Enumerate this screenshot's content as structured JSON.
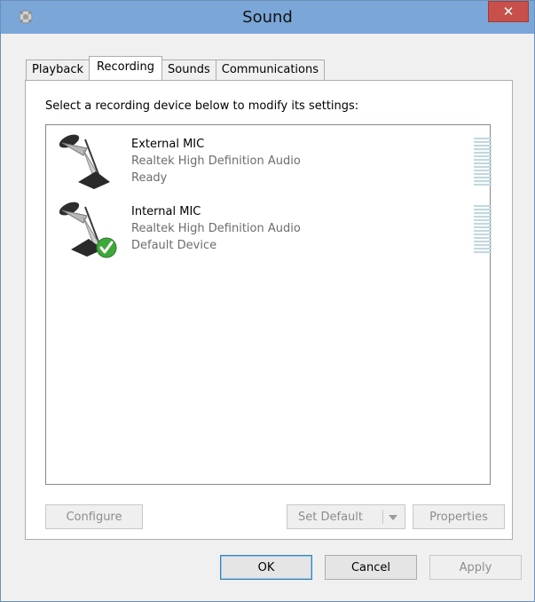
{
  "window": {
    "title": "Sound",
    "icon": "speaker-icon",
    "close_glyph": "✕"
  },
  "tabs": [
    {
      "label": "Playback",
      "active": false
    },
    {
      "label": "Recording",
      "active": true
    },
    {
      "label": "Sounds",
      "active": false
    },
    {
      "label": "Communications",
      "active": false
    }
  ],
  "panel": {
    "instruction": "Select a recording device below to modify its settings:"
  },
  "devices": [
    {
      "name": "External MIC",
      "driver": "Realtek High Definition Audio",
      "status": "Ready",
      "icon": "microphone-icon",
      "is_default": false
    },
    {
      "name": "Internal MIC",
      "driver": "Realtek High Definition Audio",
      "status": "Default Device",
      "icon": "microphone-icon",
      "is_default": true
    }
  ],
  "buttons": {
    "configure": "Configure",
    "set_default": "Set Default",
    "properties": "Properties",
    "ok": "OK",
    "cancel": "Cancel",
    "apply": "Apply"
  },
  "colors": {
    "titlebar": "#7aa7d8",
    "close": "#c7504a",
    "meter": "#bcd9e5",
    "default_check": "#3fa83a"
  }
}
